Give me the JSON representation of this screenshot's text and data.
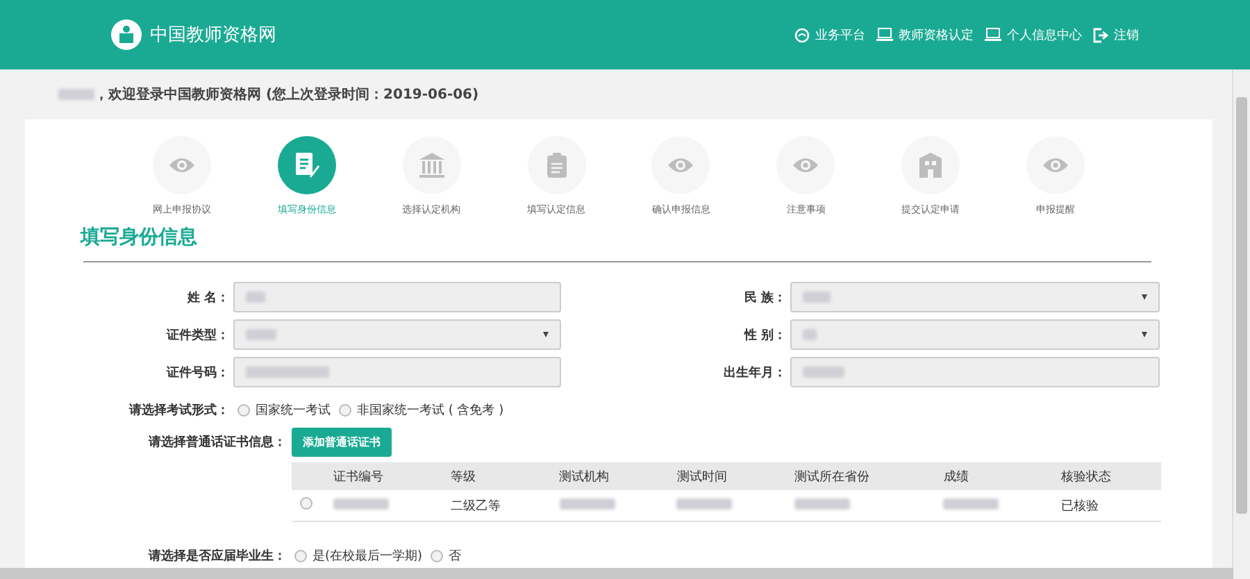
{
  "header": {
    "logo_text": "中国教师资格网",
    "nav": [
      {
        "kind": "platform",
        "label": "业务平台"
      },
      {
        "kind": "monitor",
        "label": "教师资格认定"
      },
      {
        "kind": "monitor",
        "label": "个人信息中心"
      },
      {
        "kind": "logout",
        "label": "注销"
      }
    ]
  },
  "welcome": {
    "text": "，欢迎登录中国教师资格网 (您上次登录时间：2019-06-06)"
  },
  "steps": [
    {
      "kind": "eye",
      "label": "网上申报协议",
      "selected": false
    },
    {
      "kind": "form",
      "label": "填写身份信息",
      "selected": true
    },
    {
      "kind": "bank",
      "label": "选择认定机构",
      "selected": false
    },
    {
      "kind": "clipboard",
      "label": "填写认定信息",
      "selected": false
    },
    {
      "kind": "eye",
      "label": "确认申报信息",
      "selected": false
    },
    {
      "kind": "eye",
      "label": "注意事项",
      "selected": false
    },
    {
      "kind": "building",
      "label": "提交认定申请",
      "selected": false
    },
    {
      "kind": "eye",
      "label": "申报提醒",
      "selected": false
    }
  ],
  "section_title": "填写身份信息",
  "fields": [
    {
      "label": "姓 名：",
      "kind": "text"
    },
    {
      "label": "民 族：",
      "kind": "select"
    },
    {
      "label": "证件类型：",
      "kind": "select"
    },
    {
      "label": "性 别：",
      "kind": "select"
    },
    {
      "label": "证件号码：",
      "kind": "text"
    },
    {
      "label": "出生年月：",
      "kind": "text"
    }
  ],
  "exam_type": {
    "label": "请选择考试形式：",
    "options": [
      {
        "label": "国家统一考试",
        "selected": false
      },
      {
        "label": "非国家统一考试 ( 含免考 )",
        "selected": false
      }
    ]
  },
  "certificate": {
    "label": "请选择普通话证书信息：",
    "add_button": "添加普通话证书",
    "columns": [
      "证书编号",
      "等级",
      "测试机构",
      "测试时间",
      "测试所在省份",
      "成绩",
      "核验状态"
    ],
    "rows": [
      {
        "selected": false,
        "cells": [
          {
            "redacted": true
          },
          {
            "text": "二级乙等"
          },
          {
            "redacted": true
          },
          {
            "redacted": true
          },
          {
            "redacted": true
          },
          {
            "redacted": true
          },
          {
            "text": "已核验"
          }
        ]
      }
    ]
  },
  "graduate": {
    "label": "请选择是否应届毕业生：",
    "options": [
      {
        "label": "是(在校最后一学期)",
        "selected": false
      },
      {
        "label": "否",
        "selected": false
      }
    ]
  }
}
